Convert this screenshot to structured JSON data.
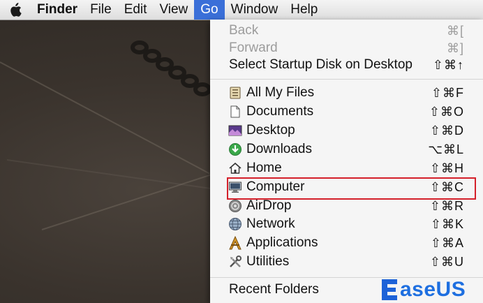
{
  "menubar": {
    "apple_icon": "apple-icon",
    "items": [
      {
        "label": "Finder"
      },
      {
        "label": "File"
      },
      {
        "label": "Edit"
      },
      {
        "label": "View"
      },
      {
        "label": "Go"
      },
      {
        "label": "Window"
      },
      {
        "label": "Help"
      }
    ]
  },
  "go_menu": {
    "items": [
      {
        "label": "Back",
        "shortcut": "⌘[",
        "enabled": false
      },
      {
        "label": "Forward",
        "shortcut": "⌘]",
        "enabled": false
      },
      {
        "label": "Select Startup Disk on Desktop",
        "shortcut": "⇧⌘↑",
        "enabled": true
      },
      {
        "label": "All My Files",
        "shortcut": "⇧⌘F",
        "icon": "all-my-files-icon"
      },
      {
        "label": "Documents",
        "shortcut": "⇧⌘O",
        "icon": "documents-icon"
      },
      {
        "label": "Desktop",
        "shortcut": "⇧⌘D",
        "icon": "desktop-icon"
      },
      {
        "label": "Downloads",
        "shortcut": "⌥⌘L",
        "icon": "downloads-icon"
      },
      {
        "label": "Home",
        "shortcut": "⇧⌘H",
        "icon": "home-icon"
      },
      {
        "label": "Computer",
        "shortcut": "⇧⌘C",
        "icon": "computer-icon",
        "highlighted": true
      },
      {
        "label": "AirDrop",
        "shortcut": "⇧⌘R",
        "icon": "airdrop-icon"
      },
      {
        "label": "Network",
        "shortcut": "⇧⌘K",
        "icon": "network-icon"
      },
      {
        "label": "Applications",
        "shortcut": "⇧⌘A",
        "icon": "applications-icon"
      },
      {
        "label": "Utilities",
        "shortcut": "⇧⌘U",
        "icon": "utilities-icon"
      },
      {
        "label": "Recent Folders"
      }
    ]
  },
  "watermark": {
    "brand": "EaseUS",
    "brand_rest": "aseUS"
  },
  "colors": {
    "accent": "#3a6fd8",
    "highlight_box": "#d4202a",
    "logo": "#1e6fe0"
  }
}
